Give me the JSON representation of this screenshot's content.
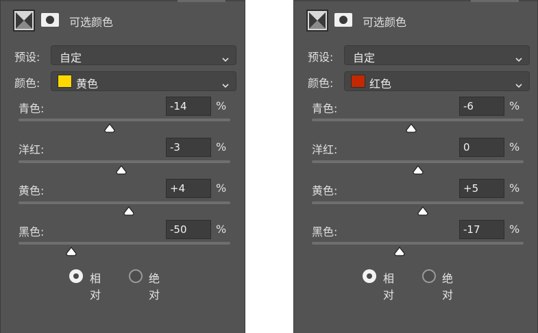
{
  "panels": [
    {
      "id": "left",
      "title": "可选颜色",
      "preset": {
        "label": "预设:",
        "value": "自定"
      },
      "colors": {
        "label": "颜色:",
        "value": "黄色",
        "swatch": "#ffd800"
      },
      "sliders": [
        {
          "key": "cyan",
          "label": "青色:",
          "value": "-14",
          "unit": "%",
          "level_percent": -14
        },
        {
          "key": "magenta",
          "label": "洋红:",
          "value": "-3",
          "unit": "%",
          "level_percent": -3
        },
        {
          "key": "yellow",
          "label": "黄色:",
          "value": "+4",
          "unit": "%",
          "level_percent": 4
        },
        {
          "key": "black",
          "label": "黑色:",
          "value": "-50",
          "unit": "%",
          "level_percent": -50
        }
      ],
      "method": {
        "relative": "相对",
        "absolute": "绝对",
        "selected": "relative"
      }
    },
    {
      "id": "right",
      "title": "可选颜色",
      "preset": {
        "label": "预设:",
        "value": "自定"
      },
      "colors": {
        "label": "颜色:",
        "value": "红色",
        "swatch": "#c42800"
      },
      "sliders": [
        {
          "key": "cyan",
          "label": "青色:",
          "value": "-6",
          "unit": "%",
          "level_percent": -6
        },
        {
          "key": "magenta",
          "label": "洋红:",
          "value": "0",
          "unit": "%",
          "level_percent": 0
        },
        {
          "key": "yellow",
          "label": "黄色:",
          "value": "+5",
          "unit": "%",
          "level_percent": 5
        },
        {
          "key": "black",
          "label": "黑色:",
          "value": "-17",
          "unit": "%",
          "level_percent": -17
        }
      ],
      "method": {
        "relative": "相对",
        "absolute": "绝对",
        "selected": "relative"
      }
    }
  ],
  "icons": {
    "adjustment_layer": "selective-color-layer-icon",
    "mask": "layer-mask-icon",
    "dropdown": "chevron-down-icon"
  }
}
